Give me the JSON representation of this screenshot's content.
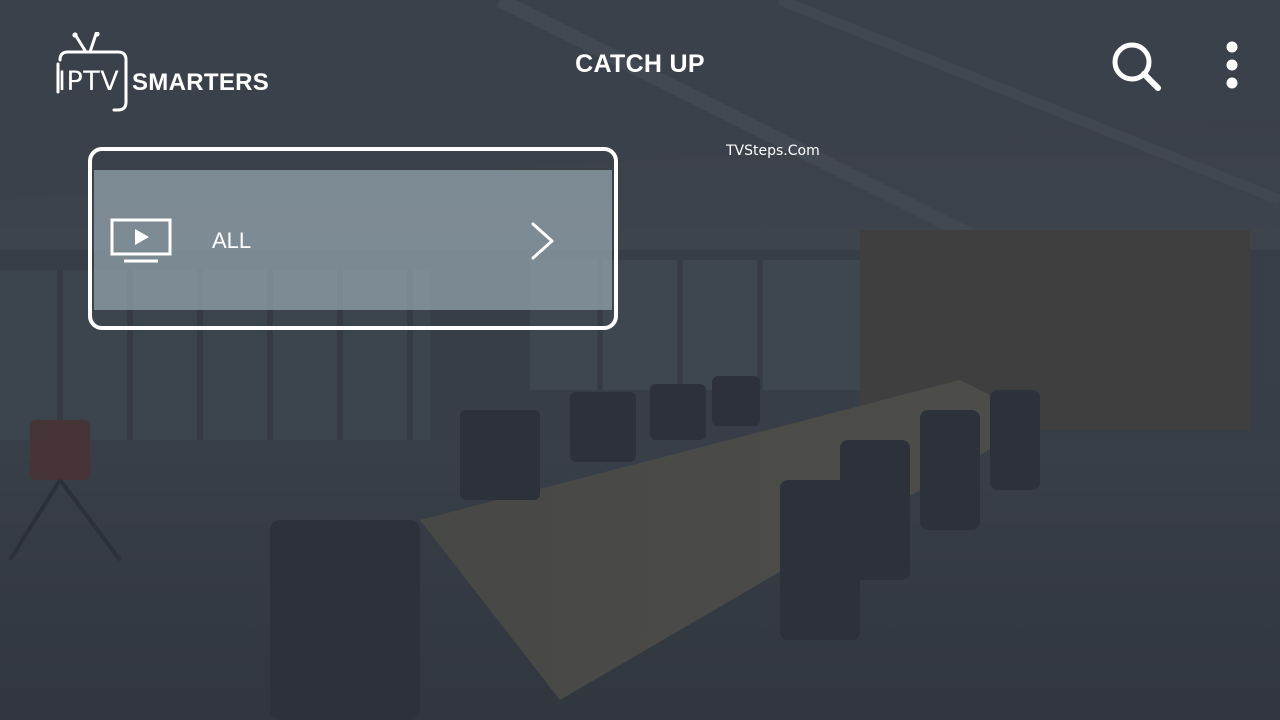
{
  "app": {
    "logo_iptv": "IPTV",
    "logo_smarters": "SMARTERS"
  },
  "header": {
    "title": "CATCH UP",
    "search_icon": "search-icon",
    "more_icon": "more-vertical-icon"
  },
  "watermark": "TVSteps.Com",
  "categories": [
    {
      "label": "ALL",
      "icon": "tv-play-icon",
      "selected": true
    }
  ],
  "colors": {
    "text": "#ffffff",
    "focus_border": "#ffffff",
    "item_background": "#96a6b0"
  }
}
